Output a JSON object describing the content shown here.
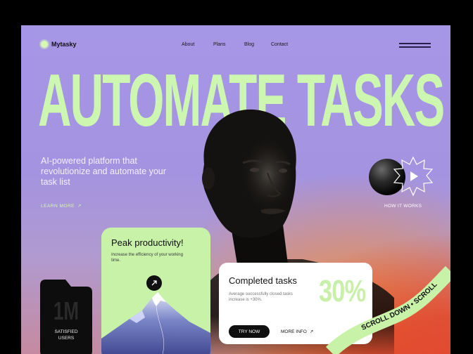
{
  "brand": {
    "name": "Mytasky"
  },
  "nav": {
    "items": [
      "About",
      "Plans",
      "Blog",
      "Contact"
    ]
  },
  "hero": {
    "headline": "AUTOMATE TASKS",
    "intro": "AI-powered platform that revolutionize and automate your task list",
    "learn_more": "LEARN MORE"
  },
  "how_it_works": {
    "label": "HOW IT WORKS"
  },
  "peak_card": {
    "title": "Peak productivity!",
    "subtitle": "Increase the efficiency of your working time."
  },
  "stats_card": {
    "value": "1M",
    "label_line1": "SATISFIED",
    "label_line2": "USERS"
  },
  "completed_card": {
    "title": "Completed tasks",
    "subtitle": "Average successfully closed tasks increase is +30%.",
    "percent": "30%",
    "try_now": "TRY NOW",
    "more_info": "MORE INFO"
  },
  "ribbon": {
    "text": "SCROLL DOWN • SCROLL"
  },
  "colors": {
    "accent_green": "#cdf7b1",
    "lavender": "#a696e6",
    "orange": "#e2452a",
    "dark": "#0f0f0f"
  },
  "icons": [
    "logo-flower-icon",
    "menu-icon",
    "arrow-up-right-icon",
    "play-icon"
  ]
}
